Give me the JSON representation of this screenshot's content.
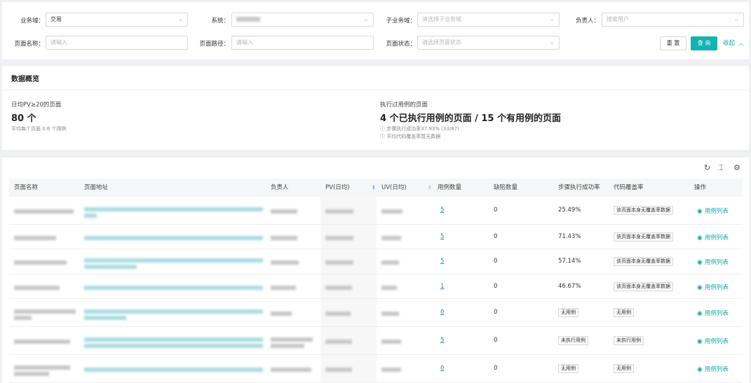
{
  "filters": {
    "business_domain": {
      "label": "业务域：",
      "value": "交易"
    },
    "system": {
      "label": "系统："
    },
    "sub_domain": {
      "label": "子业务域：",
      "placeholder": "请选择子业务域"
    },
    "owner": {
      "label": "负责人：",
      "placeholder": "搜索用户"
    },
    "page_name": {
      "label": "页面名称：",
      "placeholder": "请输入"
    },
    "page_path": {
      "label": "页面路径：",
      "placeholder": "请输入"
    },
    "page_status": {
      "label": "页面状态：",
      "placeholder": "请选择页面状态"
    },
    "reset_label": "重 置",
    "query_label": "查 询",
    "collapse_label": "收起"
  },
  "overview": {
    "title": "数据概览",
    "left": {
      "label": "日均PV≥20的页面",
      "value": "80 个",
      "sub": "平均每个页面 0.6 个用例"
    },
    "right": {
      "label": "执行过用例的页面",
      "value": "4 个已执行用例的页面 / 15 个有用例的页面",
      "sub1": "步骤执行成功率37.93% (33/87)",
      "sub2": "平均代码覆盖率暂无数据"
    }
  },
  "table": {
    "columns": [
      "页面名称",
      "页面地址",
      "负责人",
      "PV(日均)",
      "UV(日均)",
      "用例数量",
      "缺陷数量",
      "步骤执行成功率",
      "代码覆盖率",
      "操作"
    ],
    "action_label": "用例列表",
    "rows": [
      {
        "cases": "5",
        "defects": "0",
        "rate": "25.49%",
        "coverage": "该页面本身无覆盖率数据"
      },
      {
        "cases": "5",
        "defects": "0",
        "rate": "71.43%",
        "coverage": "该页面本身无覆盖率数据"
      },
      {
        "cases": "5",
        "defects": "0",
        "rate": "57.14%",
        "coverage": "该页面本身无覆盖率数据"
      },
      {
        "cases": "1",
        "defects": "0",
        "rate": "46.67%",
        "coverage": "该页面本身无覆盖率数据"
      },
      {
        "cases": "0",
        "defects": "0",
        "rate": "无用例",
        "coverage": "无用例"
      },
      {
        "cases": "5",
        "defects": "0",
        "rate": "未执行用例",
        "coverage": "未执行用例"
      },
      {
        "cases": "0",
        "defects": "0",
        "rate": "无用例",
        "coverage": "无用例"
      }
    ]
  },
  "icons": {
    "refresh": "refresh-icon",
    "density": "column-height-icon",
    "settings": "gear-icon",
    "eye": "eye-icon",
    "chevron_down": "chevron-down-icon",
    "chevron_up": "chevron-up-icon",
    "sort": "sort-icon",
    "info": "info-circle-icon"
  },
  "colors": {
    "accent": "#12b3b1",
    "link": "#1a8fa0"
  }
}
